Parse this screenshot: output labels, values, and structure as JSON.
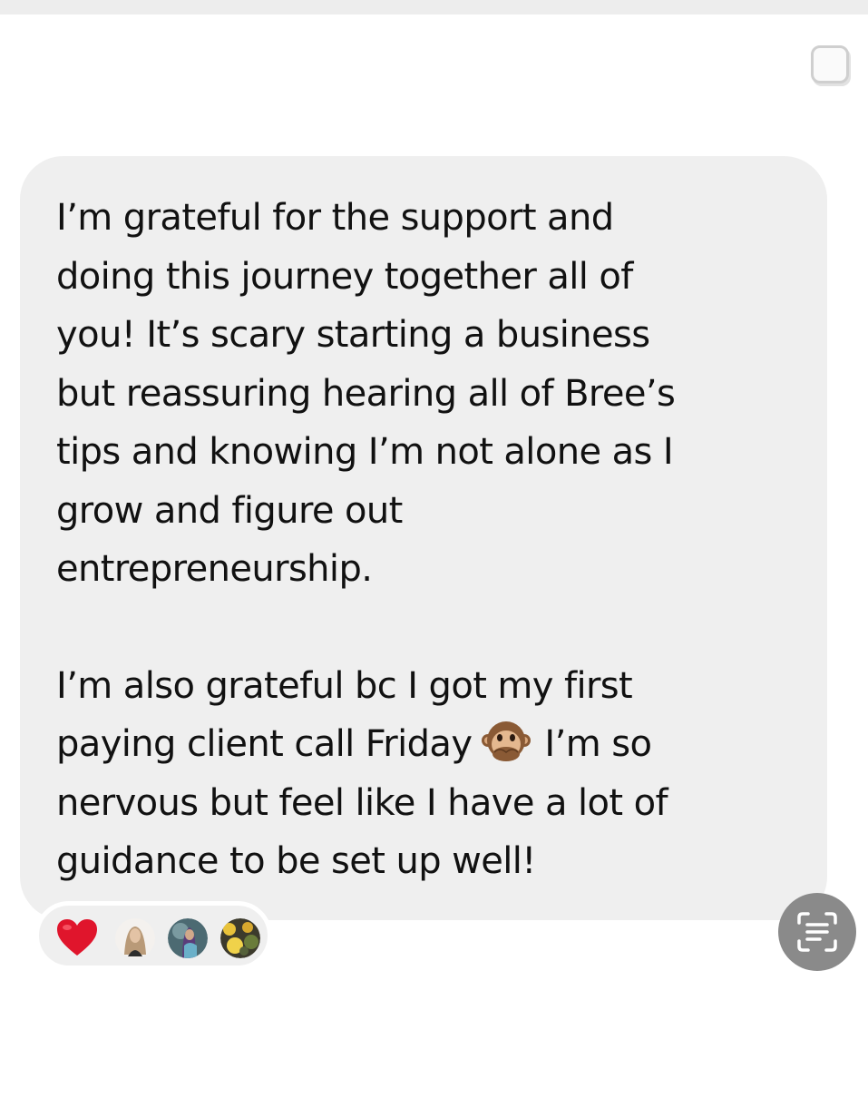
{
  "message": {
    "paragraph_1": [
      "I’m grateful for the support and",
      "doing this journey together all of",
      "you! It’s scary starting a business",
      "but reassuring hearing all of Bree’s",
      "tips and knowing I’m not alone as I",
      "grow and figure out",
      "entrepreneurship."
    ],
    "paragraph_2": {
      "line_1": "I’m also grateful bc I got my first",
      "line_2_before_emoji": "paying client call Friday",
      "emoji": "speak-no-evil-monkey-icon",
      "line_2_after_emoji": "I’m so",
      "line_3": "nervous but feel like I have a lot of",
      "line_4": "guidance to be set up well!"
    },
    "bubble_color": "#efefef"
  },
  "reactions": {
    "items": [
      {
        "type": "heart-icon",
        "color": "#e0152c"
      },
      {
        "type": "avatar"
      },
      {
        "type": "avatar"
      },
      {
        "type": "avatar"
      }
    ]
  },
  "controls": {
    "select_checkbox": "checkbox-icon",
    "live_text": "live-text-icon"
  }
}
